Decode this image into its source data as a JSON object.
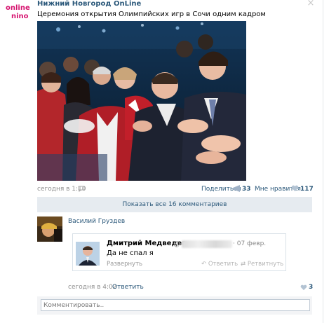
{
  "post": {
    "group_name": "Нижний Новгород OnLine",
    "logo_line1": "online",
    "logo_line2": "nino",
    "text": "Церемония открытия Олимпийских игр в Сочи одним кадром",
    "date": "сегодня в 1:10",
    "share_label": "Поделиться",
    "share_count": "33",
    "like_label": "Мне нравится",
    "like_count": "117",
    "close_icon": "×"
  },
  "comments": {
    "show_all_label": "Показать все 16 комментариев",
    "items": [
      {
        "author": "Василий Груздев",
        "date": "сегодня в 4:02",
        "reply_label": "Ответить",
        "like_count": "3",
        "tweet": {
          "author": "Дмитрий Медведев",
          "handle_prefix": "@",
          "date": "· 07 февр.",
          "text": "Да не спал я",
          "expand_label": "Развернуть",
          "reply_label": "Ответить",
          "retweet_label": "Ретвитнуть"
        }
      }
    ],
    "input_placeholder": "Комментировать.."
  },
  "colors": {
    "link": "#2b587a",
    "meta": "#8f8f8f",
    "bar": "#e6ebf0",
    "logo_pink": "#d6136f"
  },
  "icons": {
    "close": "close-icon",
    "comments": "comment-icon",
    "share": "megaphone-icon",
    "like": "heart-icon",
    "tweet_reply": "reply-arrow-icon",
    "tweet_retweet": "retweet-icon"
  }
}
